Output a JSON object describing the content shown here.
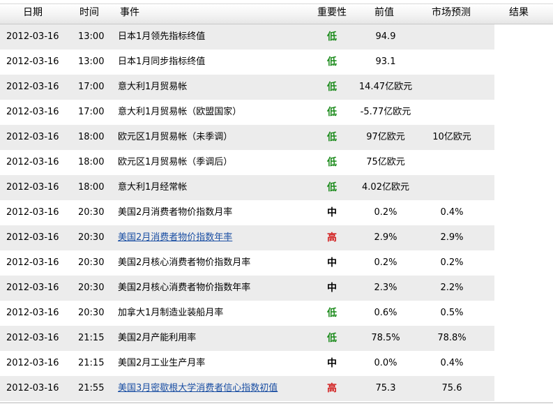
{
  "headers": {
    "date": "日期",
    "time": "时间",
    "event": "事件",
    "importance": "重要性",
    "previous": "前值",
    "forecast": "市场预测",
    "result": "结果"
  },
  "colors": {
    "low": "#1a8a1a",
    "medium": "#1c2fa8",
    "high": "#d21d1d",
    "link": "#1b4fa3",
    "row_shade": "#ececec"
  },
  "rows": [
    {
      "date": "2012-03-16",
      "time": "13:00",
      "event": "日本1月领先指标终值",
      "importance": "低",
      "level": "low",
      "previous": "94.9",
      "forecast": "",
      "link": false
    },
    {
      "date": "2012-03-16",
      "time": "13:00",
      "event": "日本1月同步指标终值",
      "importance": "低",
      "level": "low",
      "previous": "93.1",
      "forecast": "",
      "link": false
    },
    {
      "date": "2012-03-16",
      "time": "17:00",
      "event": "意大利1月贸易帐",
      "importance": "低",
      "level": "low",
      "previous": "14.47亿欧元",
      "forecast": "",
      "link": false
    },
    {
      "date": "2012-03-16",
      "time": "17:00",
      "event": "意大利1月贸易帐（欧盟国家）",
      "importance": "低",
      "level": "low",
      "previous": "-5.77亿欧元",
      "forecast": "",
      "link": false
    },
    {
      "date": "2012-03-16",
      "time": "18:00",
      "event": "欧元区1月贸易帐（未季调）",
      "importance": "低",
      "level": "low",
      "previous": "97亿欧元",
      "forecast": "10亿欧元",
      "link": false
    },
    {
      "date": "2012-03-16",
      "time": "18:00",
      "event": "欧元区1月贸易帐（季调后）",
      "importance": "低",
      "level": "low",
      "previous": "75亿欧元",
      "forecast": "",
      "link": false
    },
    {
      "date": "2012-03-16",
      "time": "18:00",
      "event": "意大利1月经常帐",
      "importance": "低",
      "level": "low",
      "previous": "4.02亿欧元",
      "forecast": "",
      "link": false
    },
    {
      "date": "2012-03-16",
      "time": "20:30",
      "event": "美国2月消费者物价指数月率",
      "importance": "中",
      "level": "medium",
      "previous": "0.2%",
      "forecast": "0.4%",
      "link": false
    },
    {
      "date": "2012-03-16",
      "time": "20:30",
      "event": "美国2月消费者物价指数年率",
      "importance": "高",
      "level": "high",
      "previous": "2.9%",
      "forecast": "2.9%",
      "link": true
    },
    {
      "date": "2012-03-16",
      "time": "20:30",
      "event": "美国2月核心消费者物价指数月率",
      "importance": "中",
      "level": "medium",
      "previous": "0.2%",
      "forecast": "0.2%",
      "link": false
    },
    {
      "date": "2012-03-16",
      "time": "20:30",
      "event": "美国2月核心消费者物价指数年率",
      "importance": "中",
      "level": "medium",
      "previous": "2.3%",
      "forecast": "2.2%",
      "link": false
    },
    {
      "date": "2012-03-16",
      "time": "20:30",
      "event": "加拿大1月制造业装船月率",
      "importance": "低",
      "level": "low",
      "previous": "0.6%",
      "forecast": "0.5%",
      "link": false
    },
    {
      "date": "2012-03-16",
      "time": "21:15",
      "event": "美国2月产能利用率",
      "importance": "低",
      "level": "low",
      "previous": "78.5%",
      "forecast": "78.8%",
      "link": false
    },
    {
      "date": "2012-03-16",
      "time": "21:15",
      "event": "美国2月工业生产月率",
      "importance": "中",
      "level": "medium",
      "previous": "0.0%",
      "forecast": "0.4%",
      "link": false
    },
    {
      "date": "2012-03-16",
      "time": "21:55",
      "event": "美国3月密歇根大学消费者信心指数初值",
      "importance": "高",
      "level": "high",
      "previous": "75.3",
      "forecast": "75.6",
      "link": true
    }
  ]
}
